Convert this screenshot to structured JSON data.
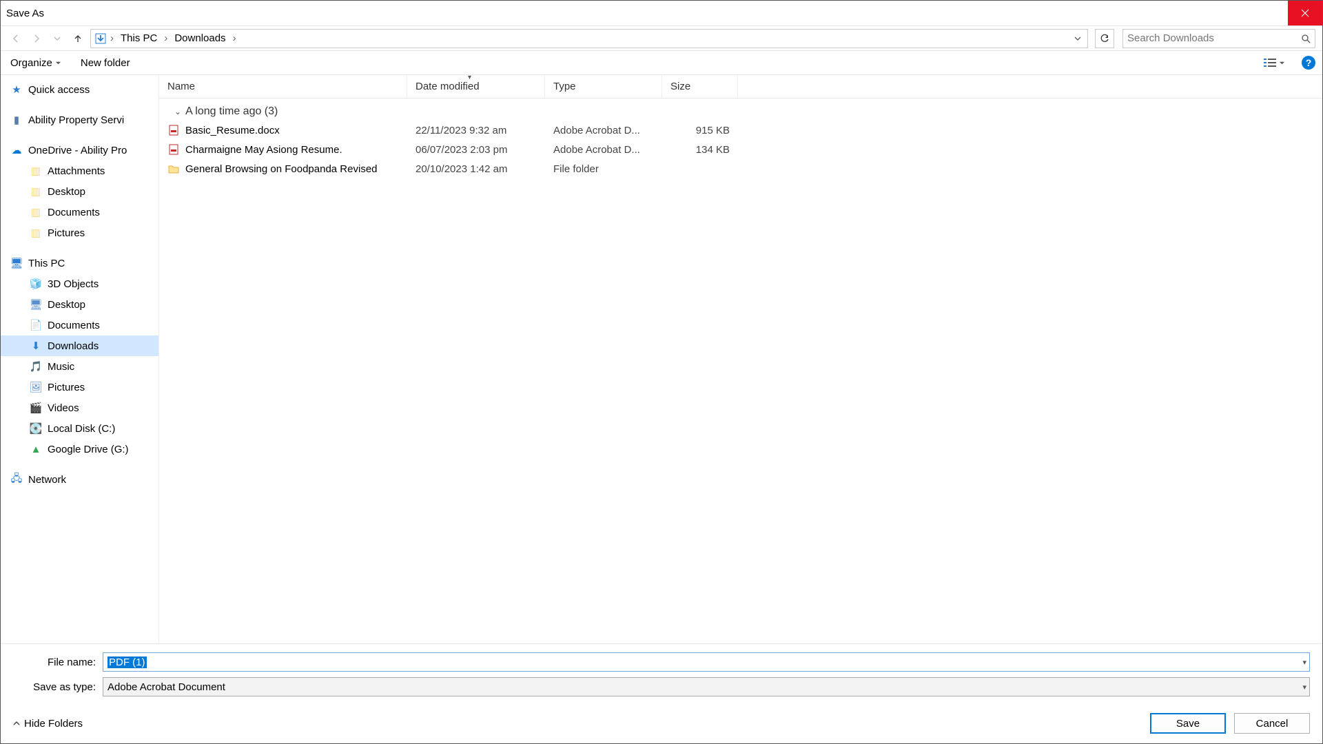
{
  "title": "Save As",
  "breadcrumb": {
    "segments": [
      "This PC",
      "Downloads"
    ]
  },
  "search": {
    "placeholder": "Search Downloads"
  },
  "toolbar": {
    "organize": "Organize",
    "new_folder": "New folder"
  },
  "columns": {
    "name": "Name",
    "date": "Date modified",
    "type": "Type",
    "size": "Size"
  },
  "group": {
    "label": "A long time ago (3)"
  },
  "files": [
    {
      "icon": "pdf",
      "name": "Basic_Resume.docx",
      "date": "22/11/2023 9:32 am",
      "type": "Adobe Acrobat D...",
      "size": "915 KB"
    },
    {
      "icon": "pdf",
      "name": "Charmaigne May Asiong Resume.",
      "date": "06/07/2023 2:03 pm",
      "type": "Adobe Acrobat D...",
      "size": "134 KB"
    },
    {
      "icon": "folder",
      "name": "General Browsing on Foodpanda Revised",
      "date": "20/10/2023 1:42 am",
      "type": "File folder",
      "size": ""
    }
  ],
  "sidebar": {
    "quick": "Quick access",
    "ability": "Ability Property Servi",
    "onedrive": "OneDrive - Ability Pro",
    "onedrive_children": [
      "Attachments",
      "Desktop",
      "Documents",
      "Pictures"
    ],
    "thispc": "This PC",
    "thispc_children": [
      {
        "label": "3D Objects",
        "key": "3d"
      },
      {
        "label": "Desktop",
        "key": "desktop"
      },
      {
        "label": "Documents",
        "key": "documents"
      },
      {
        "label": "Downloads",
        "key": "downloads",
        "selected": true
      },
      {
        "label": "Music",
        "key": "music"
      },
      {
        "label": "Pictures",
        "key": "pictures"
      },
      {
        "label": "Videos",
        "key": "videos"
      },
      {
        "label": "Local Disk (C:)",
        "key": "cdrive"
      },
      {
        "label": "Google Drive (G:)",
        "key": "gdrive"
      }
    ],
    "network": "Network"
  },
  "form": {
    "filename_label": "File name:",
    "filename_value": "PDF (1)",
    "savetype_label": "Save as type:",
    "savetype_value": "Adobe Acrobat Document"
  },
  "footer": {
    "hide": "Hide Folders",
    "save": "Save",
    "cancel": "Cancel"
  }
}
